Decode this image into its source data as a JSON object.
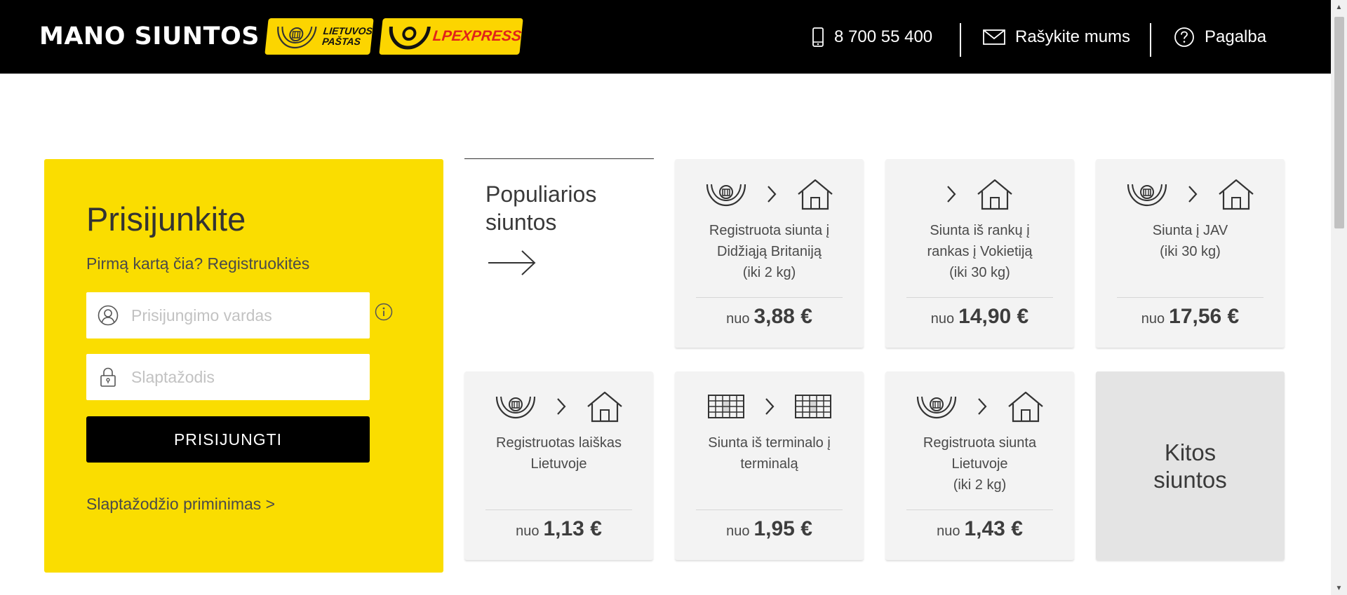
{
  "header": {
    "brand": "MANO SIUNTOS",
    "logo_lp_text_1": "LIETUVOS",
    "logo_lp_text_2": "PAŠTAS",
    "logo_lpx_text_lp": "LP",
    "logo_lpx_text_express": "EXPRESS",
    "phone": "8 700 55 400",
    "mail": "Rašykite mums",
    "help": "Pagalba",
    "phone_icon": "phone-icon",
    "mail_icon": "envelope-icon",
    "help_icon": "question-circle-icon"
  },
  "login": {
    "title": "Prisijunkite",
    "register_prompt": "Pirmą kartą čia? Registruokitės",
    "username_placeholder": "Prisijungimo vardas",
    "username_value": "",
    "password_placeholder": "Slaptažodis",
    "password_value": "",
    "submit_label": "PRISIJUNGTI",
    "forgot_label": "Slaptažodžio priminimas >"
  },
  "popular": {
    "title_line1": "Populiarios",
    "title_line2": "siuntos"
  },
  "cards": [
    {
      "desc1": "Registruota siunta į",
      "desc2": "Didžiąją Britaniją",
      "desc3": "(iki 2 kg)",
      "from": "nuo",
      "price": "3,88 €"
    },
    {
      "desc1": "Siunta iš rankų į",
      "desc2": "rankas į Vokietiją",
      "desc3": "(iki 30 kg)",
      "from": "nuo",
      "price": "14,90 €"
    },
    {
      "desc1": "Siunta į JAV",
      "desc2": "(iki 30 kg)",
      "desc3": "",
      "from": "nuo",
      "price": "17,56 €"
    },
    {
      "desc1": "Registruotas laiškas",
      "desc2": "Lietuvoje",
      "desc3": "",
      "from": "nuo",
      "price": "1,13 €"
    },
    {
      "desc1": "Siunta iš terminalo į",
      "desc2": "terminalą",
      "desc3": "",
      "from": "nuo",
      "price": "1,95 €"
    },
    {
      "desc1": "Registruota siunta",
      "desc2": "Lietuvoje",
      "desc3": "(iki 2 kg)",
      "from": "nuo",
      "price": "1,43 €"
    }
  ],
  "more": {
    "line1": "Kitos",
    "line2": "siuntos"
  },
  "colors": {
    "accent": "#fadd00",
    "header_bg": "#000000",
    "card_bg": "#f3f3f3"
  }
}
